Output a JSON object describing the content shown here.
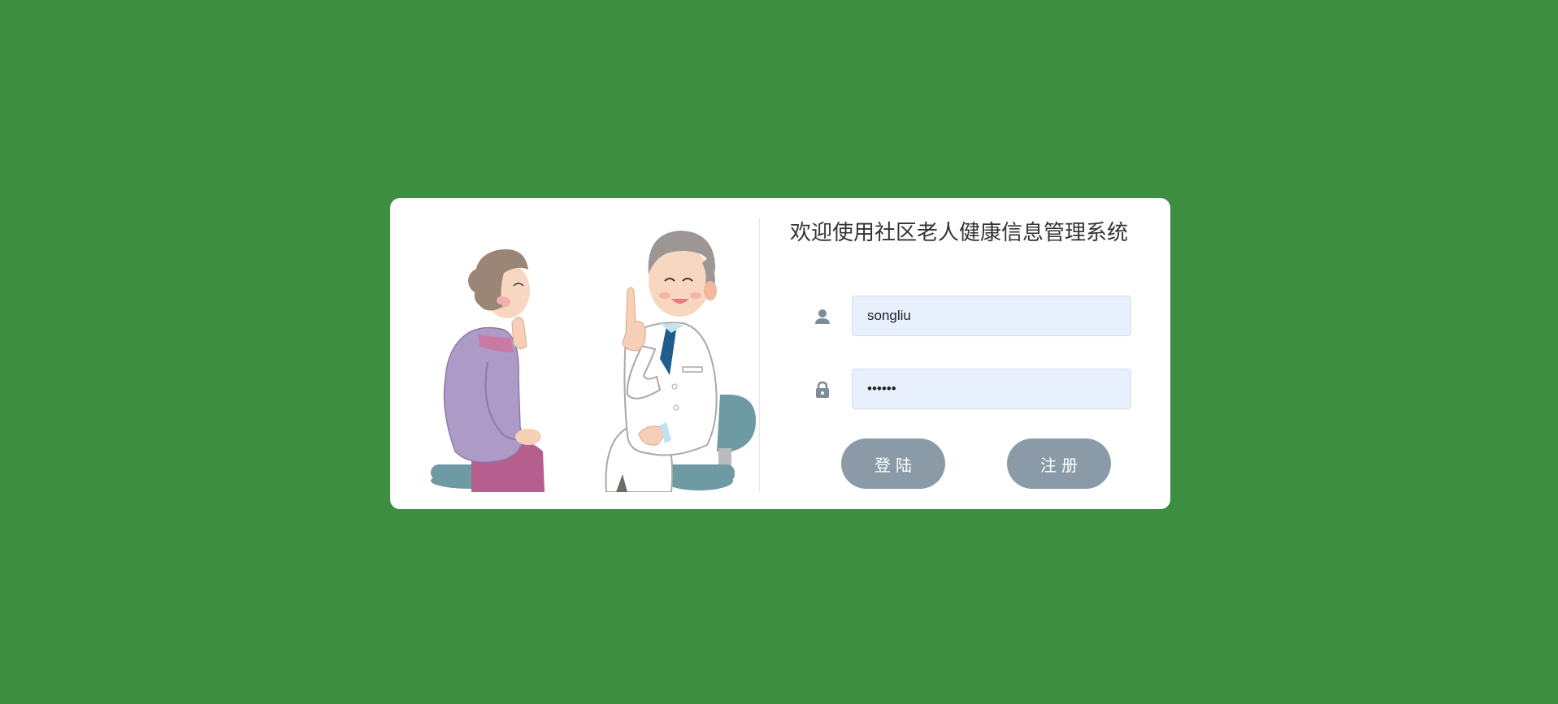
{
  "page": {
    "background_color": "#3e8e41",
    "card_color": "#ffffff"
  },
  "login": {
    "title": "欢迎使用社区老人健康信息管理系统",
    "username": {
      "icon": "user-icon",
      "value": "songliu"
    },
    "password": {
      "icon": "lock-icon",
      "value": "••••••"
    },
    "buttons": {
      "login_label": "登陆",
      "register_label": "注册",
      "color": "#8a9ba7"
    }
  },
  "illustration": {
    "description_icon": "doctor-patient-illustration"
  }
}
